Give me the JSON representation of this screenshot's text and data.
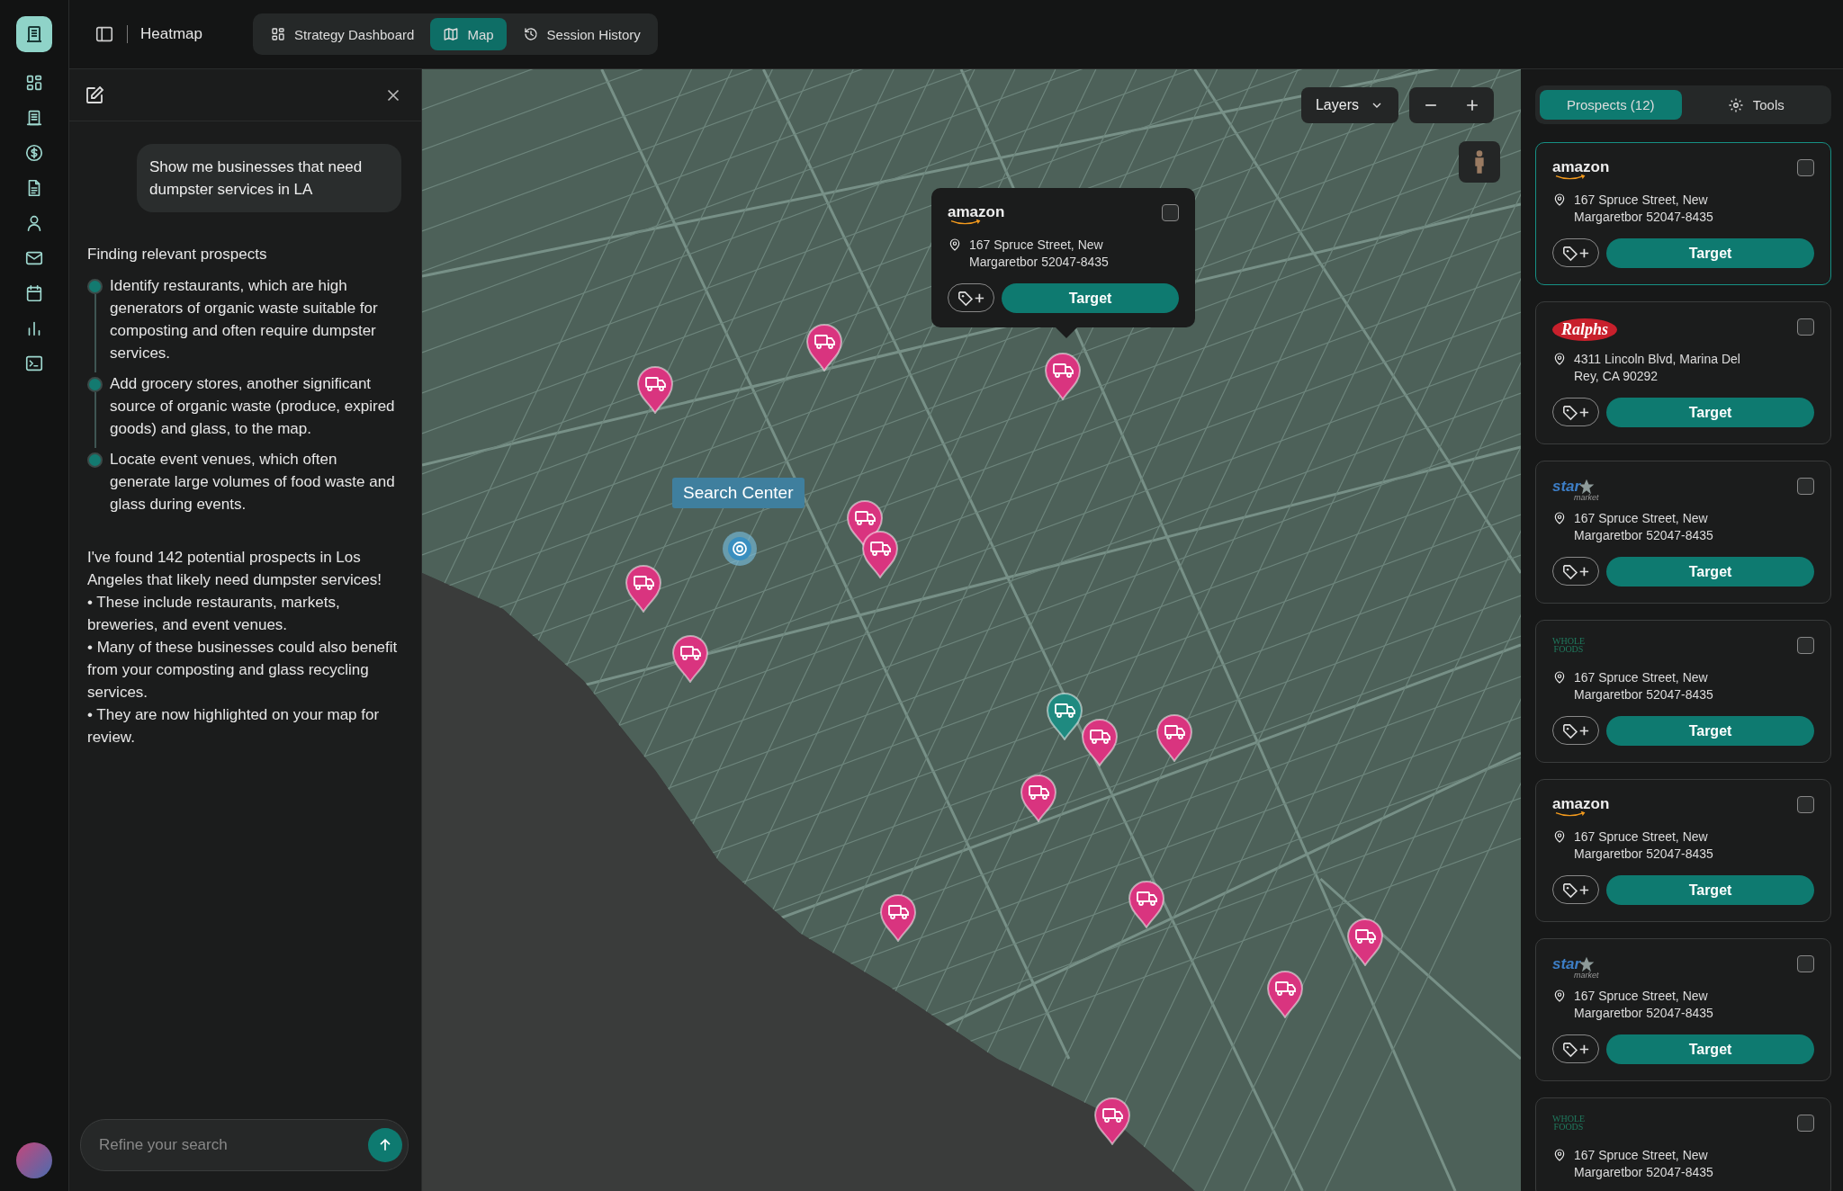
{
  "topbar": {
    "title": "Heatmap",
    "tabs": [
      {
        "label": "Strategy Dashboard",
        "selected": false
      },
      {
        "label": "Map",
        "selected": true
      },
      {
        "label": "Session History",
        "selected": false
      }
    ]
  },
  "chat": {
    "user_message": "Show me businesses that need dumpster services in LA",
    "status": "Finding relevant prospects",
    "steps": [
      "Identify restaurants, which are high generators of organic waste suitable for composting and often require dumpster services.",
      "Add grocery stores, another significant source of organic waste (produce, expired goods) and glass, to the map.",
      "Locate event venues, which often generate large volumes of food waste and glass during events."
    ],
    "answer": [
      "I've found 142 potential prospects in Los Angeles that likely need dumpster services!",
      "• These include restaurants, markets, breweries, and event venues.",
      "• Many of these businesses could also benefit from your composting and glass recycling services.",
      "• They are now highlighted on your map for review."
    ],
    "input": {
      "placeholder": "Refine your search"
    }
  },
  "map": {
    "search_center": "Search Center",
    "layers_button": "Layers",
    "pins": [
      {
        "color": "#d9347f"
      },
      {
        "color": "#d9347f"
      },
      {
        "color": "#d9347f"
      },
      {
        "color": "#d9347f"
      },
      {
        "color": "#d9347f"
      },
      {
        "color": "#d9347f"
      },
      {
        "color": "#d9347f"
      },
      {
        "color": "#1f8a80"
      },
      {
        "color": "#d9347f"
      },
      {
        "color": "#d9347f"
      },
      {
        "color": "#d9347f"
      },
      {
        "color": "#d9347f"
      },
      {
        "color": "#d9347f"
      },
      {
        "color": "#d9347f"
      },
      {
        "color": "#d9347f"
      },
      {
        "color": "#d9347f"
      }
    ],
    "popup": {
      "logo": {
        "kind": "amazon",
        "text": "amazon"
      },
      "address": "167 Spruce Street, New Margaretbor 52047-8435",
      "checked": false,
      "target_label": "Target"
    }
  },
  "panel": {
    "tabs": [
      {
        "label": "Prospects (12)",
        "selected": true
      },
      {
        "label": "Tools",
        "selected": false
      }
    ],
    "cards": [
      {
        "logo": {
          "kind": "amazon",
          "text": "amazon"
        },
        "address": "167 Spruce Street, New Margaretbor 52047-8435",
        "checked": false,
        "selected": true,
        "target_label": "Target"
      },
      {
        "logo": {
          "kind": "ralphs",
          "text": "Ralphs"
        },
        "address": "4311 Lincoln Blvd, Marina Del Rey, CA 90292",
        "checked": false,
        "selected": false,
        "target_label": "Target"
      },
      {
        "logo": {
          "kind": "star",
          "text": "star",
          "sub": "market"
        },
        "address": "167 Spruce Street, New Margaretbor 52047-8435",
        "checked": false,
        "selected": false,
        "target_label": "Target"
      },
      {
        "logo": {
          "kind": "wholefoods",
          "text": "WHOLE FOODS"
        },
        "address": "167 Spruce Street, New Margaretbor 52047-8435",
        "checked": false,
        "selected": false,
        "target_label": "Target"
      },
      {
        "logo": {
          "kind": "amazon",
          "text": "amazon"
        },
        "address": "167 Spruce Street, New Margaretbor 52047-8435",
        "checked": false,
        "selected": false,
        "target_label": "Target"
      },
      {
        "logo": {
          "kind": "star",
          "text": "star",
          "sub": "market"
        },
        "address": "167 Spruce Street, New Margaretbor 52047-8435",
        "checked": false,
        "selected": false,
        "target_label": "Target"
      },
      {
        "logo": {
          "kind": "wholefoods",
          "text": "WHOLE FOODS"
        },
        "address": "167 Spruce Street, New Margaretbor 52047-8435",
        "checked": false,
        "selected": false
      }
    ]
  }
}
